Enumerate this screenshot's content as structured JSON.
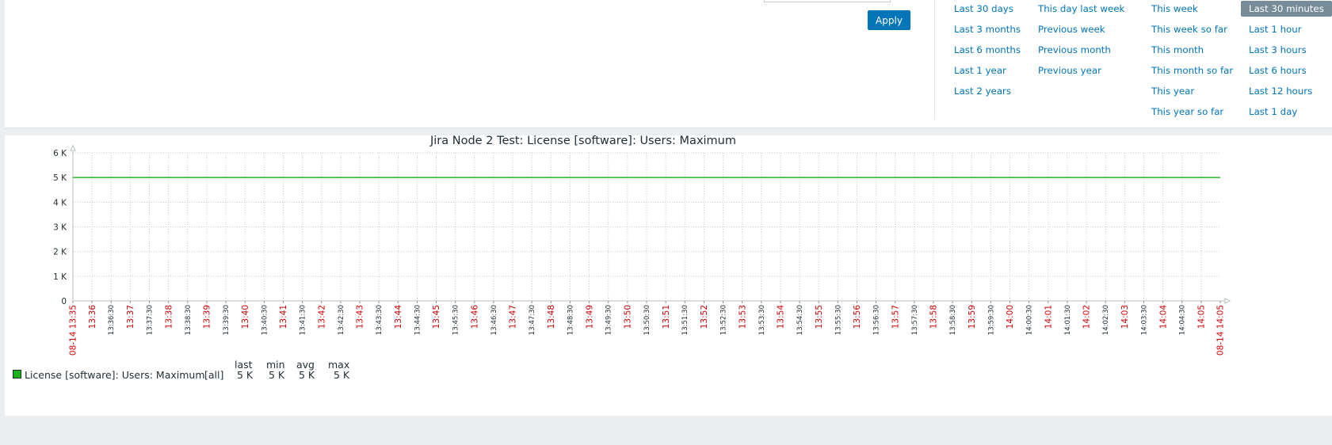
{
  "filter": {
    "apply_label": "Apply",
    "quick_ranges": [
      [
        "Last 30 days",
        "Last 3 months",
        "Last 6 months",
        "Last 1 year",
        "Last 2 years"
      ],
      [
        "This day last week",
        "Previous week",
        "Previous month",
        "Previous year"
      ],
      [
        "This week",
        "This week so far",
        "This month",
        "This month so far",
        "This year",
        "This year so far"
      ],
      [
        "Last 30 minutes",
        "Last 1 hour",
        "Last 3 hours",
        "Last 6 hours",
        "Last 12 hours",
        "Last 1 day"
      ]
    ],
    "selected": "Last 30 minutes"
  },
  "colors": {
    "link": "#0275b8",
    "apply_bg": "#0275b8",
    "selected_bg": "#768d99",
    "series": "#1ab31a",
    "minute_tick": "#d40000",
    "grid": "#c8c8c8"
  },
  "chart_data": {
    "type": "line",
    "title": "Jira Node 2 Test: License [software]: Users: Maximum",
    "y_ticks": [
      "0",
      "1 K",
      "2 K",
      "3 K",
      "4 K",
      "5 K",
      "6 K"
    ],
    "ylim": [
      0,
      6000
    ],
    "x_start_label": "08-14 13:35",
    "x_end_label": "08-14 14:05",
    "x_tick_labels": [
      "13:36",
      "13:36:30",
      "13:37",
      "13:37:30",
      "13:38",
      "13:38:30",
      "13:39",
      "13:39:30",
      "13:40",
      "13:40:30",
      "13:41",
      "13:41:30",
      "13:42",
      "13:42:30",
      "13:43",
      "13:43:30",
      "13:44",
      "13:44:30",
      "13:45",
      "13:45:30",
      "13:46",
      "13:46:30",
      "13:47",
      "13:47:30",
      "13:48",
      "13:48:30",
      "13:49",
      "13:49:30",
      "13:50",
      "13:50:30",
      "13:51",
      "13:51:30",
      "13:52",
      "13:52:30",
      "13:53",
      "13:53:30",
      "13:54",
      "13:54:30",
      "13:55",
      "13:55:30",
      "13:56",
      "13:56:30",
      "13:57",
      "13:57:30",
      "13:58",
      "13:58:30",
      "13:59",
      "13:59:30",
      "14:00",
      "14:00:30",
      "14:01",
      "14:01:30",
      "14:02",
      "14:02:30",
      "14:03",
      "14:03:30",
      "14:04",
      "14:04:30",
      "14:05"
    ],
    "series": [
      {
        "name": "License [software]: Users: Maximum",
        "x": [
          "13:35",
          "14:05"
        ],
        "values": [
          5000,
          5000
        ]
      }
    ],
    "grid": true
  },
  "legend": {
    "headers": [
      "last",
      "min",
      "avg",
      "max"
    ],
    "items": [
      {
        "name": "License [software]: Users: Maximum",
        "scope": "[all]",
        "last": "5 K",
        "min": "5 K",
        "avg": "5 K",
        "max": "5 K"
      }
    ]
  }
}
